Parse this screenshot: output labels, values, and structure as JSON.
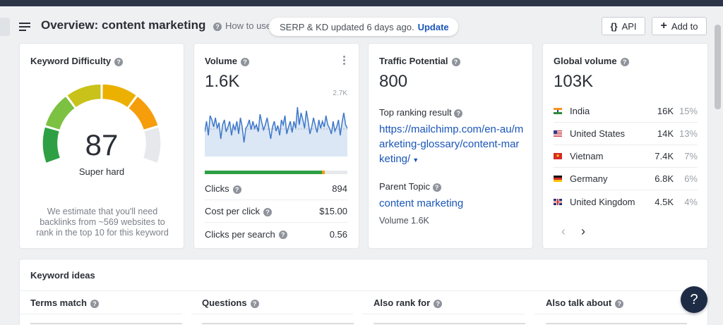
{
  "header": {
    "title": "Overview: content marketing",
    "howto": "How to use",
    "serp_text": "SERP & KD updated 6 days ago.",
    "update": "Update",
    "api_label": "API",
    "add_label": "Add to"
  },
  "kd": {
    "title": "Keyword Difficulty",
    "value": "87",
    "label": "Super hard",
    "note": "We estimate that you'll need backlinks from ~569 websites to rank in the top 10 for this keyword"
  },
  "volume": {
    "title": "Volume",
    "value": "1.6K",
    "spark_max": "2.7K",
    "organic_share": 0.82,
    "metrics": [
      {
        "label": "Clicks",
        "value": "894"
      },
      {
        "label": "Cost per click",
        "value": "$15.00"
      },
      {
        "label": "Clicks per search",
        "value": "0.56"
      }
    ]
  },
  "traffic": {
    "title": "Traffic Potential",
    "value": "800",
    "top_result_label": "Top ranking result",
    "top_result_url": "https://mailchimp.com/en-au/marketing-glossary/content-marketing/",
    "parent_topic_label": "Parent Topic",
    "parent_topic": "content marketing",
    "parent_volume": "Volume 1.6K"
  },
  "global": {
    "title": "Global volume",
    "value": "103K",
    "countries": [
      {
        "name": "India",
        "value": "16K",
        "pct": "15%",
        "flag": "in"
      },
      {
        "name": "United States",
        "value": "14K",
        "pct": "13%",
        "flag": "us"
      },
      {
        "name": "Vietnam",
        "value": "7.4K",
        "pct": "7%",
        "flag": "vn"
      },
      {
        "name": "Germany",
        "value": "6.8K",
        "pct": "6%",
        "flag": "de"
      },
      {
        "name": "United Kingdom",
        "value": "4.5K",
        "pct": "4%",
        "flag": "gb"
      }
    ],
    "prev": "‹",
    "next": "›"
  },
  "keyword_ideas": {
    "title": "Keyword ideas",
    "columns": [
      "Terms match",
      "Questions",
      "Also rank for",
      "Also talk about"
    ]
  },
  "help": "?",
  "colors": {
    "link": "#1a56b7",
    "gauge": [
      "#2ea043",
      "#7cc142",
      "#c8c21a",
      "#ebb000",
      "#f59d0a",
      "#e6e8eb"
    ],
    "spark_line": "#3f78c9",
    "spark_fill": "#dbe7f5"
  }
}
